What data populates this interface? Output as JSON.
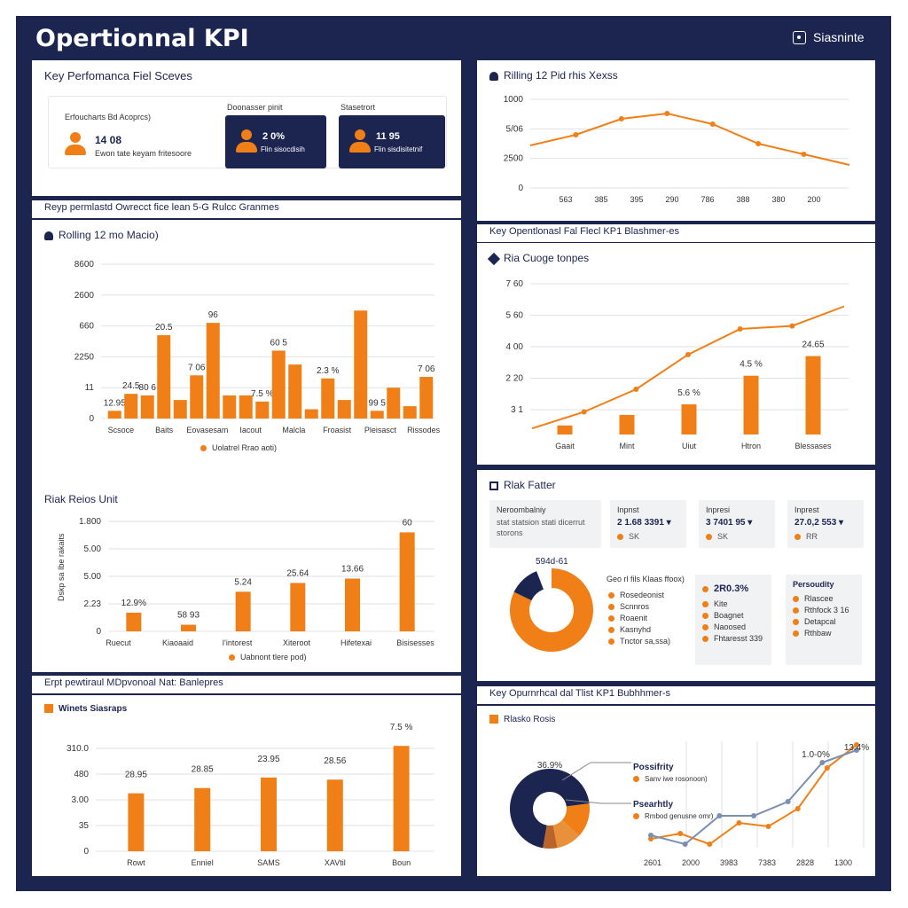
{
  "header": {
    "title": "Opertionnal KPI",
    "right_label": "Siasninte"
  },
  "colors": {
    "navy": "#1c2450",
    "orange": "#f07f17",
    "grid": "#dfe2e8",
    "axis": "#555555"
  },
  "kpi_panel": {
    "title": "Key Perfomanca Fiel Sceves",
    "card1": {
      "caption": "Erfoucharts Bd Acoprcs)",
      "value": "14 08",
      "sub": "Ewon tate keyam fritesoore"
    },
    "card2": {
      "caption": "Doonasser pinit",
      "value": "2 0%",
      "sub": "Flin sisocdisih"
    },
    "card3": {
      "caption": "Stasetrort",
      "value": "11 95",
      "sub": "Flin sisdisitetnif"
    }
  },
  "separators": {
    "s1": "Reyp permlastd Owrecct fice lean 5-G Rulcc Granmes",
    "s2": "Key Opentlonasl Fal Flecl KP1 Blashmer-es",
    "s3": "Erpt pewtiraul MDpvonoal Nat: Banlepres",
    "s4": "Key Opurnrhcal dal Tlist KP1 Bubhhmer-s"
  },
  "rolling_chart": {
    "title": "Rilling 12 Pid rhis Xexss",
    "chart_data": {
      "type": "line",
      "x": [
        "563",
        "385",
        "395",
        "290",
        "786",
        "388",
        "380",
        "200"
      ],
      "y_ticks": [
        "0",
        "2500",
        "5/06",
        "1000"
      ],
      "values": [
        48,
        60,
        78,
        84,
        72,
        50,
        38,
        26
      ],
      "ylim": [
        0,
        100
      ]
    }
  },
  "bar_chart_main": {
    "title": "Rolling 12 mo Macio)",
    "legend": "Uolatrel Rrao aoti)",
    "chart_data": {
      "type": "bar",
      "y_ticks": [
        "0",
        "11",
        "2250",
        "660",
        "2600",
        "8600"
      ],
      "categories": [
        "Scsoce",
        "Baits",
        "Eovasesam",
        "Iacout",
        "Malcla",
        "Froasist",
        "Pleisasct",
        "Rissodes"
      ],
      "values": [
        5,
        16,
        15,
        54,
        12,
        28,
        62,
        15,
        15,
        11,
        44,
        35,
        6,
        26,
        12,
        70,
        5,
        20,
        8,
        27
      ],
      "labels": [
        "12.95",
        "24.5",
        "80 6",
        "20.5",
        "",
        "7 06",
        "96",
        "",
        "",
        "7.5 %",
        "60 5",
        "",
        "",
        "2.3 %",
        "",
        "",
        "99 5",
        "",
        "",
        "7 06"
      ]
    }
  },
  "combo_chart": {
    "title": "Ria Cuoge tonpes",
    "chart_data": {
      "type": "bar",
      "categories": [
        "Gaait",
        "Mint",
        "Uiut",
        "Htron",
        "Blessases"
      ],
      "y_ticks": [
        "3 1",
        "2 20",
        "4 00",
        "5 60",
        "7 60"
      ],
      "values": [
        6,
        13,
        20,
        39,
        52
      ],
      "line": [
        4,
        15,
        30,
        53,
        70,
        72,
        85
      ],
      "labels": [
        "",
        "",
        "5.6 %",
        "4.5 %",
        "24.65"
      ]
    }
  },
  "risk_chart": {
    "title": "Riak Reios Unit",
    "ylabel": "Dskp sa Ibe rakaits",
    "legend": "Uabnont tlere pod)",
    "chart_data": {
      "type": "bar",
      "y_ticks": [
        "0",
        "2.23",
        "5.00",
        "5.00",
        "1.800"
      ],
      "categories": [
        "Ruecut",
        "Kiaoaaid",
        "I'intorest",
        "Xiteroot",
        "Hifetexai",
        "Bisisesses"
      ],
      "values": [
        17,
        6,
        36,
        44,
        48,
        90
      ],
      "labels": [
        "12.9%",
        "58 93",
        "5.24",
        "25.64",
        "13.66",
        "60"
      ]
    }
  },
  "risk_factor": {
    "title": "Rlak Fatter",
    "box1": {
      "t": "Neroombalniy",
      "s1": "stat statsion stati dicerrut",
      "s2": "storons"
    },
    "box2": {
      "t": "Inpnst",
      "v": "2 1.68 3391 ▾",
      "s": "SK"
    },
    "box3": {
      "t": "Inpresi",
      "v": "3 7401 95 ▾",
      "s": "SK"
    },
    "box4": {
      "t": "Inprest",
      "v": "27.0,2 553 ▾",
      "s": "RR"
    },
    "donut_label": "594d-61",
    "list_title": "Geo rl fils Klaas ffoox)",
    "list": [
      "Rosedeonist",
      "Scnnros",
      "Roaenit",
      "Kasnyhd",
      "Tnctor sa,ssa)"
    ],
    "mid": {
      "v": "2R0.3%",
      "items": [
        "Kite",
        "Boagnet",
        "Naoosed",
        "Fhtaresst 339"
      ]
    },
    "right": {
      "t": "Persoudity",
      "items": [
        "Rlascee",
        "Rthfock 3 16",
        "Detapcal",
        "Rthbaw"
      ]
    },
    "chart_data": {
      "type": "pie",
      "values": [
        82,
        12,
        6
      ],
      "colors": [
        "#f07f17",
        "#1c2450",
        "#ffffff"
      ]
    }
  },
  "winners_chart": {
    "title": "Winets Siasraps",
    "chart_data": {
      "type": "bar",
      "y_ticks": [
        "0",
        "35",
        "3.00",
        "480",
        "310.0"
      ],
      "categories": [
        "Rowt",
        "Enniel",
        "SAMS",
        "XAVtil",
        "Boun"
      ],
      "values": [
        55,
        60,
        70,
        68,
        100
      ],
      "labels": [
        "28.95",
        "28.85",
        "23.95",
        "28.56",
        "7.5 %"
      ]
    }
  },
  "risko_chart": {
    "title": "Rlasko Rosis",
    "donut_value": "36.9%",
    "callout1": {
      "t": "Possifrity",
      "s": "Sanv iwe rosonoon)"
    },
    "callout2": {
      "t": "Psearhtly",
      "s": "Rmbod genusne omr)"
    },
    "chart_data": {
      "type": "line",
      "x": [
        "2601",
        "2000",
        "3983",
        "7383",
        "2828",
        "1300"
      ],
      "series": [
        {
          "values": [
            5,
            8,
            2,
            14,
            12,
            22,
            45,
            58
          ]
        },
        {
          "values": [
            7,
            2,
            18,
            18,
            26,
            48,
            55
          ]
        }
      ],
      "labels": [
        "1.0-0%",
        "13.4%"
      ],
      "donut": [
        70,
        14,
        10,
        6
      ]
    }
  }
}
